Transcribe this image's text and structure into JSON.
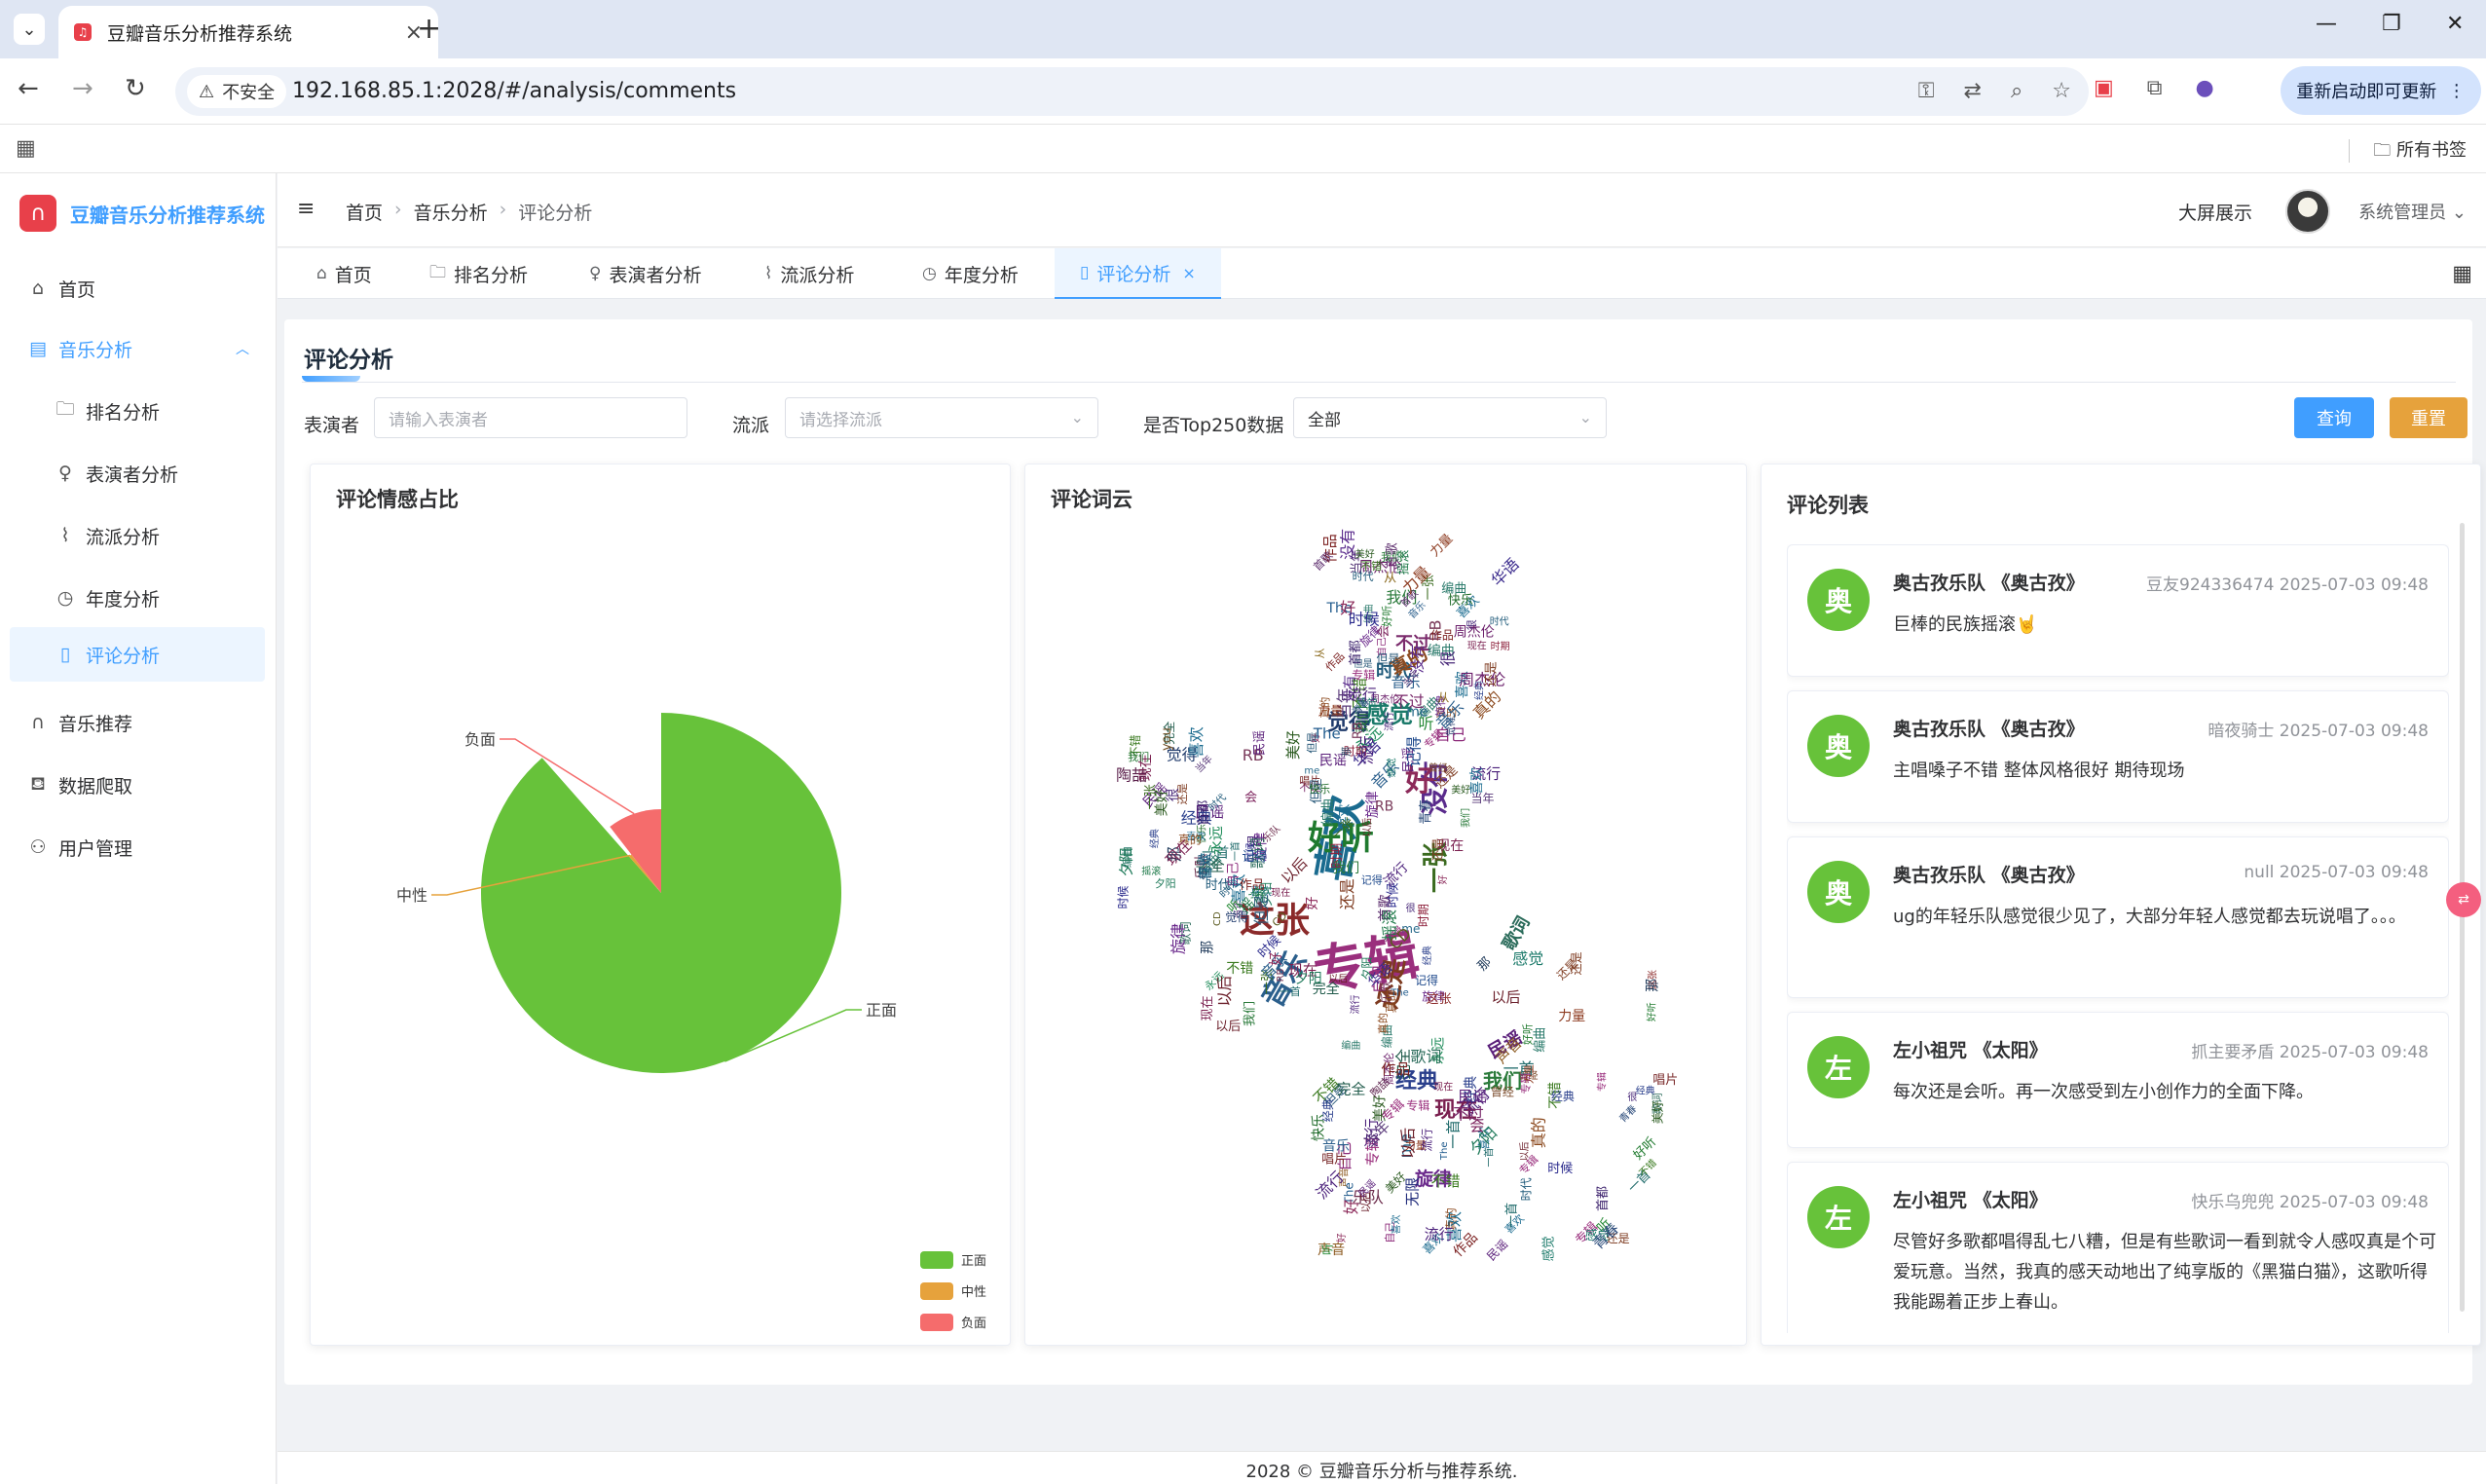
{
  "browser": {
    "tab_title": "豆瓣音乐分析推荐系统",
    "insecure_label": "不安全",
    "url": "192.168.85.1:2028/#/analysis/comments",
    "update_button": "重新启动即可更新",
    "all_bookmarks": "所有书签"
  },
  "app": {
    "logo_text": "豆瓣音乐分析推荐系统"
  },
  "sidebar": {
    "items": [
      {
        "label": "首页",
        "icon": "home-icon"
      },
      {
        "label": "音乐分析",
        "icon": "chart-icon"
      },
      {
        "label": "排名分析",
        "icon": "folder-icon"
      },
      {
        "label": "表演者分析",
        "icon": "bulb-icon"
      },
      {
        "label": "流派分析",
        "icon": "paperclip-icon"
      },
      {
        "label": "年度分析",
        "icon": "compass-icon"
      },
      {
        "label": "评论分析",
        "icon": "book-icon"
      },
      {
        "label": "音乐推荐",
        "icon": "headphones-icon"
      },
      {
        "label": "数据爬取",
        "icon": "basket-icon"
      },
      {
        "label": "用户管理",
        "icon": "user-icon"
      }
    ]
  },
  "header": {
    "breadcrumb": [
      "首页",
      "音乐分析",
      "评论分析"
    ],
    "big_screen": "大屏展示",
    "user_name": "系统管理员"
  },
  "tags": [
    {
      "label": "首页",
      "icon": "home-icon"
    },
    {
      "label": "排名分析",
      "icon": "folder-icon"
    },
    {
      "label": "表演者分析",
      "icon": "bulb-icon"
    },
    {
      "label": "流派分析",
      "icon": "paperclip-icon"
    },
    {
      "label": "年度分析",
      "icon": "compass-icon"
    },
    {
      "label": "评论分析",
      "icon": "book-icon",
      "active": true
    }
  ],
  "page": {
    "title": "评论分析"
  },
  "filters": {
    "performer_label": "表演者",
    "performer_placeholder": "请输入表演者",
    "genre_label": "流派",
    "genre_placeholder": "请选择流派",
    "top250_label": "是否Top250数据",
    "top250_value": "全部",
    "query_button": "查询",
    "reset_button": "重置"
  },
  "sentiment_card": {
    "title": "评论情感占比"
  },
  "wordcloud_card": {
    "title": "评论词云"
  },
  "comments_card": {
    "title": "评论列表",
    "items": [
      {
        "avatar": "奥",
        "title": "奥古孜乐队 《奥古孜》",
        "meta": "豆友924336474 2025-07-03 09:48",
        "text": "巨棒的民族摇滚🤘"
      },
      {
        "avatar": "奥",
        "title": "奥古孜乐队 《奥古孜》",
        "meta": "暗夜骑士 2025-07-03 09:48",
        "text": "主唱嗓子不错 整体风格很好 期待现场"
      },
      {
        "avatar": "奥",
        "title": "奥古孜乐队 《奥古孜》",
        "meta": "null 2025-07-03 09:48",
        "text": "ug的年轻乐队感觉很少见了，大部分年轻人感觉都去玩说唱了。。。"
      },
      {
        "avatar": "左",
        "title": "左小祖咒 《太阳》",
        "meta": "抓主要矛盾 2025-07-03 09:48",
        "text": "每次还是会听。再一次感受到左小创作力的全面下降。"
      },
      {
        "avatar": "左",
        "title": "左小祖咒 《太阳》",
        "meta": "快乐乌兜兜 2025-07-03 09:48",
        "text": "尽管好多歌都唱得乱七八糟，但是有些歌词一看到就令人感叹真是个可爱玩意。当然，我真的感天动地出了纯享版的《黑猫白猫》，这歌听得我能踢着正步上春山。"
      }
    ]
  },
  "chart_data": {
    "type": "pie",
    "title": "评论情感占比",
    "categories": [
      "正面",
      "中性",
      "负面"
    ],
    "values": [
      88.5,
      1.0,
      10.5
    ],
    "colors": [
      "#67c23a",
      "#e6a23c",
      "#f56c6c"
    ],
    "rose_type": "radius",
    "legend": {
      "position": "bottom-right",
      "items": [
        "正面",
        "中性",
        "负面"
      ]
    }
  },
  "wordcloud": {
    "words": [
      {
        "t": "专辑",
        "c": "#9a2f7d"
      },
      {
        "t": "喜欢",
        "c": "#1a6b8f"
      },
      {
        "t": "这张",
        "c": "#8b2a2a"
      },
      {
        "t": "好听",
        "c": "#1f7a2e"
      },
      {
        "t": "没有",
        "c": "#5a2b8c"
      },
      {
        "t": "音乐",
        "c": "#2b5f8c"
      },
      {
        "t": "还是",
        "c": "#7d3a1f"
      },
      {
        "t": "感觉",
        "c": "#1b7a6a"
      },
      {
        "t": "好",
        "c": "#8c2a5a"
      },
      {
        "t": "一张",
        "c": "#3a6b1f"
      },
      {
        "t": "经典",
        "c": "#2a3f8c"
      },
      {
        "t": "现在",
        "c": "#7a1f4f"
      },
      {
        "t": "时代",
        "c": "#1f5a7a"
      },
      {
        "t": "旋律",
        "c": "#6b2a8c"
      },
      {
        "t": "我们",
        "c": "#2a7a3a"
      },
      {
        "t": "真的",
        "c": "#8c4a1f"
      },
      {
        "t": "觉得",
        "c": "#1f3a6b"
      },
      {
        "t": "不过",
        "c": "#7a2a6b"
      },
      {
        "t": "歌词",
        "c": "#2a6b5a"
      },
      {
        "t": "民谣",
        "c": "#5a1f7a"
      },
      {
        "t": "快乐",
        "c": "#1f6b2a"
      },
      {
        "t": "华语",
        "c": "#3a2a8c"
      },
      {
        "t": "时期",
        "c": "#8c1f3a"
      },
      {
        "t": "美好",
        "c": "#2a5a1f"
      },
      {
        "t": "周杰伦",
        "c": "#6b1f6b"
      },
      {
        "t": "记得",
        "c": "#1f4a8c"
      },
      {
        "t": "CD",
        "c": "#5a5a1f"
      },
      {
        "t": "The",
        "c": "#1f5a8c"
      },
      {
        "t": "唱片",
        "c": "#7a2a2a"
      },
      {
        "t": "编曲",
        "c": "#2a7a6b"
      },
      {
        "t": "流行",
        "c": "#4a1f7a"
      },
      {
        "t": "声音",
        "c": "#8c5a1f"
      },
      {
        "t": "摇滚",
        "c": "#1f7a4a"
      },
      {
        "t": "乐队",
        "c": "#6b2a4a"
      },
      {
        "t": "青春",
        "c": "#2a4a7a"
      },
      {
        "t": "作品",
        "c": "#7a1f1f"
      },
      {
        "t": "一首",
        "c": "#1f6b6b"
      },
      {
        "t": "首歌",
        "c": "#5a2a6b"
      },
      {
        "t": "不错",
        "c": "#3a7a1f"
      },
      {
        "t": "自己",
        "c": "#8c2a7a"
      },
      {
        "t": "无限",
        "c": "#1f2a7a"
      },
      {
        "t": "you",
        "c": "#6b4a1f"
      },
      {
        "t": "me",
        "c": "#2a6b8c"
      },
      {
        "t": "RB",
        "c": "#7a3a5a"
      },
      {
        "t": "夕阳",
        "c": "#1f7a5a"
      },
      {
        "t": "陶喆",
        "c": "#5a1f4a"
      },
      {
        "t": "但是",
        "c": "#2a5a7a"
      },
      {
        "t": "力量",
        "c": "#8c3a1f"
      },
      {
        "t": "首都",
        "c": "#3a1f6b"
      },
      {
        "t": "永远",
        "c": "#1f8c5a"
      },
      {
        "t": "曾经",
        "c": "#7a4a2a"
      },
      {
        "t": "时候",
        "c": "#2a2a8c"
      },
      {
        "t": "以后",
        "c": "#6b1f2a"
      },
      {
        "t": "完全",
        "c": "#1f5a4a"
      },
      {
        "t": "当年",
        "c": "#5a3a7a"
      },
      {
        "t": "从",
        "c": "#8c6b1f"
      },
      {
        "t": "那",
        "c": "#1f3a5a"
      },
      {
        "t": "会",
        "c": "#7a1f5a"
      },
      {
        "t": "听",
        "c": "#2a8c3a"
      },
      {
        "t": "很",
        "c": "#4a2a7a"
      }
    ]
  }
}
